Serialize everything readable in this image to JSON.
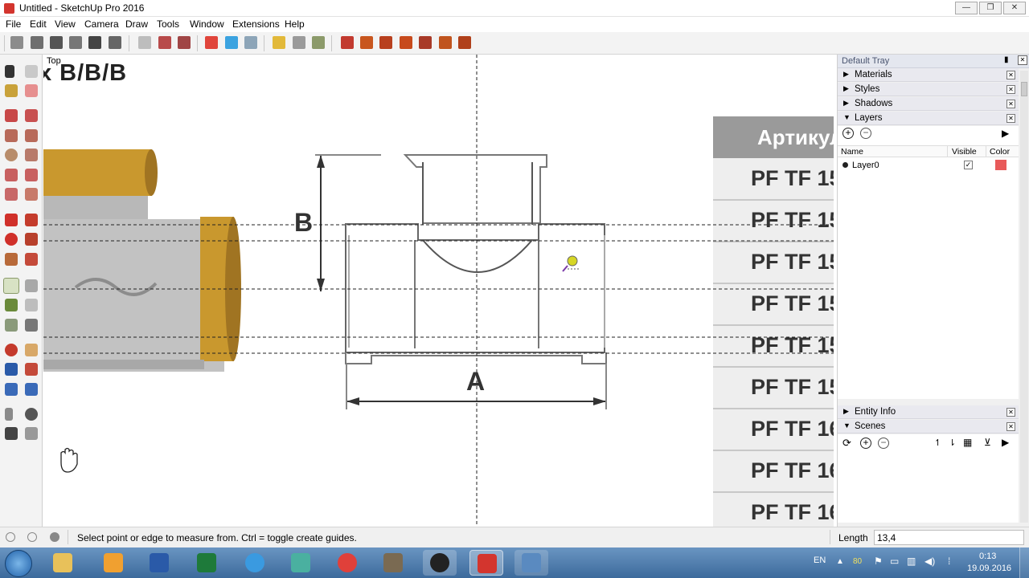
{
  "window": {
    "title": "Untitled - SketchUp Pro 2016",
    "min_glyph": "—",
    "max_glyph": "❐",
    "close_glyph": "✕"
  },
  "menu": [
    "File",
    "Edit",
    "View",
    "Camera",
    "Draw",
    "Tools",
    "Window",
    "Extensions",
    "Help"
  ],
  "canvas": {
    "view_label": "Top",
    "corner_text": "x В/В/В",
    "dim_b": "B",
    "dim_a": "A",
    "table_header": "Артикул",
    "table_rows": [
      "PF TF 15",
      "PF TF 15",
      "PF TF 15",
      "PF TF 15",
      "PF TF 15",
      "PF TF 15",
      "PF TF 16",
      "PF TF 16",
      "PF TF 16"
    ]
  },
  "tray": {
    "title": "Default Tray",
    "panels": [
      {
        "label": "Materials",
        "expanded": false
      },
      {
        "label": "Styles",
        "expanded": false
      },
      {
        "label": "Shadows",
        "expanded": false
      },
      {
        "label": "Layers",
        "expanded": true
      }
    ],
    "layers": {
      "col_name": "Name",
      "col_visible": "Visible",
      "col_color": "Color",
      "rows": [
        {
          "name": "Layer0",
          "visible": true,
          "color": "#e85a5a"
        }
      ]
    },
    "entity_info": "Entity Info",
    "scenes": "Scenes"
  },
  "status": {
    "hint": "Select point or edge to measure from.  Ctrl = toggle create guides.",
    "length_label": "Length",
    "length_value": "13,4"
  },
  "taskbar": {
    "lang": "EN",
    "tray_number": "80",
    "time": "0:13",
    "date": "19.09.2016"
  },
  "colors": {
    "accent_red": "#d3352e",
    "tray_header_bg": "#e9e9ef",
    "taskbar": "#4f7eb0"
  }
}
